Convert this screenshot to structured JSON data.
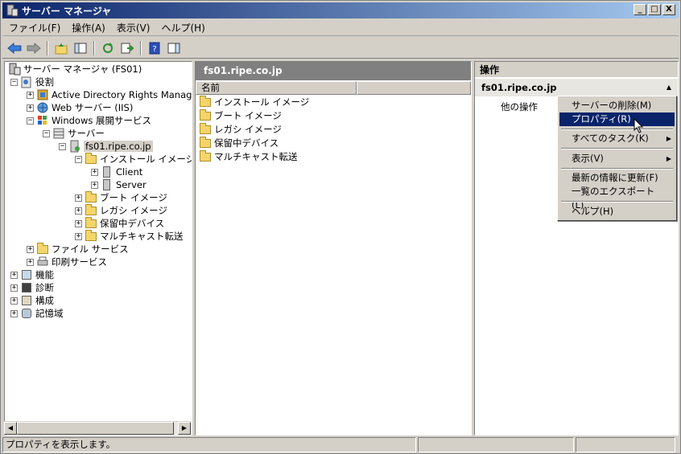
{
  "window": {
    "title": "サーバー マネージャ",
    "min": "_",
    "max": "□",
    "close": "X"
  },
  "menubar": [
    "ファイル(F)",
    "操作(A)",
    "表示(V)",
    "ヘルプ(H)"
  ],
  "tree": {
    "root": "サーバー マネージャ (FS01)",
    "roles": "役割",
    "adrm": "Active Directory Rights Manager",
    "iis": "Web サーバー (IIS)",
    "wds": "Windows 展開サービス",
    "servers": "サーバー",
    "host": "fs01.ripe.co.jp",
    "install": "インストール イメージ",
    "client": "Client",
    "server": "Server",
    "boot": "ブート イメージ",
    "legacy": "レガシ イメージ",
    "pending": "保留中デバイス",
    "multicast": "マルチキャスト転送",
    "file": "ファイル サービス",
    "print": "印刷サービス",
    "features": "機能",
    "diag": "診断",
    "config": "構成",
    "storage": "記憶域"
  },
  "middle": {
    "header": "fs01.ripe.co.jp",
    "col_name": "名前",
    "items": [
      "インストール イメージ",
      "ブート イメージ",
      "レガシ イメージ",
      "保留中デバイス",
      "マルチキャスト転送"
    ]
  },
  "actions": {
    "header": "操作",
    "sub": "fs01.ripe.co.jp",
    "other": "他の操作"
  },
  "context_menu": {
    "delete": "サーバーの削除(M)",
    "properties": "プロパティ(R)",
    "all_tasks": "すべてのタスク(K)",
    "view": "表示(V)",
    "refresh": "最新の情報に更新(F)",
    "export": "一覧のエクスポート(L)...",
    "help": "ヘルプ(H)"
  },
  "status": {
    "text": "プロパティを表示します。"
  },
  "colors": {
    "title_start": "#0a246a",
    "title_end": "#a6caf0",
    "selection": "#0a246a"
  }
}
